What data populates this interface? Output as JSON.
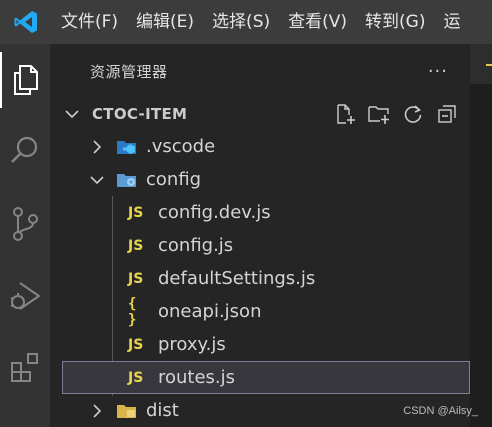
{
  "menubar": {
    "items": [
      "文件(F)",
      "编辑(E)",
      "选择(S)",
      "查看(V)",
      "转到(G)",
      "运"
    ]
  },
  "activitybar": {
    "icons": [
      "explorer-icon",
      "search-icon",
      "source-control-icon",
      "run-debug-icon",
      "extensions-icon"
    ]
  },
  "sidebar": {
    "title": "资源管理器",
    "more": "···",
    "section": {
      "title": "CTOC-ITEM",
      "actions": [
        "new-file-icon",
        "new-folder-icon",
        "refresh-icon",
        "collapse-all-icon"
      ]
    },
    "tree": [
      {
        "label": ".vscode",
        "kind": "folder",
        "expanded": false,
        "icon": "vscode-folder-icon"
      },
      {
        "label": "config",
        "kind": "folder",
        "expanded": true,
        "icon": "config-folder-icon"
      },
      {
        "label": "config.dev.js",
        "kind": "file",
        "icon": "JS"
      },
      {
        "label": "config.js",
        "kind": "file",
        "icon": "JS"
      },
      {
        "label": "defaultSettings.js",
        "kind": "file",
        "icon": "JS"
      },
      {
        "label": "oneapi.json",
        "kind": "file",
        "icon": "{ }"
      },
      {
        "label": "proxy.js",
        "kind": "file",
        "icon": "JS"
      },
      {
        "label": "routes.js",
        "kind": "file",
        "icon": "JS",
        "selected": true
      },
      {
        "label": "dist",
        "kind": "folder",
        "expanded": false,
        "icon": "dist-folder-icon"
      }
    ]
  },
  "watermark": "CSDN @Ailsy_"
}
